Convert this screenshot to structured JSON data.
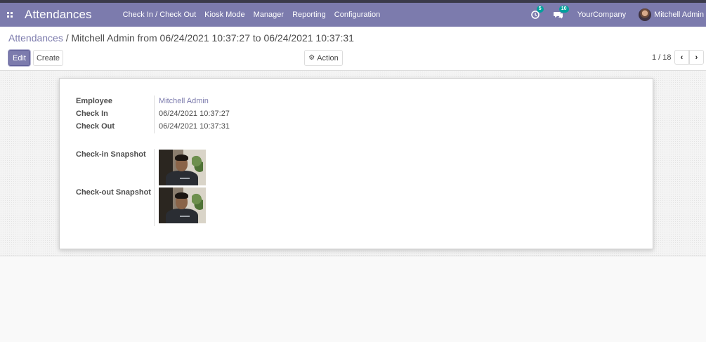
{
  "topbar": {
    "app_title": "Attendances",
    "menu": [
      "Check In / Check Out",
      "Kiosk Mode",
      "Manager",
      "Reporting",
      "Configuration"
    ],
    "activity_count": "5",
    "message_count": "10",
    "company": "YourCompany",
    "user": "Mitchell Admin",
    "icons": [
      "apps-grid-icon",
      "activity-clock-icon",
      "chat-icon",
      "user-avatar"
    ]
  },
  "breadcrumb": {
    "root": "Attendances",
    "separator": "/",
    "current": "Mitchell Admin from 06/24/2021 10:37:27 to 06/24/2021 10:37:31"
  },
  "toolbar": {
    "edit_label": "Edit",
    "create_label": "Create",
    "action_label": "Action"
  },
  "pager": {
    "value": "1 / 18",
    "prev_symbol": "‹",
    "next_symbol": "›"
  },
  "form": {
    "employee_label": "Employee",
    "employee_value": "Mitchell Admin",
    "check_in_label": "Check In",
    "check_in_value": "06/24/2021 10:37:27",
    "check_out_label": "Check Out",
    "check_out_value": "06/24/2021 10:37:31",
    "check_in_snapshot_label": "Check-in Snapshot",
    "check_out_snapshot_label": "Check-out Snapshot"
  },
  "colors": {
    "brand": "#7c7bad",
    "badge": "#00a09d",
    "topbar_border": "#3a3a4a"
  }
}
